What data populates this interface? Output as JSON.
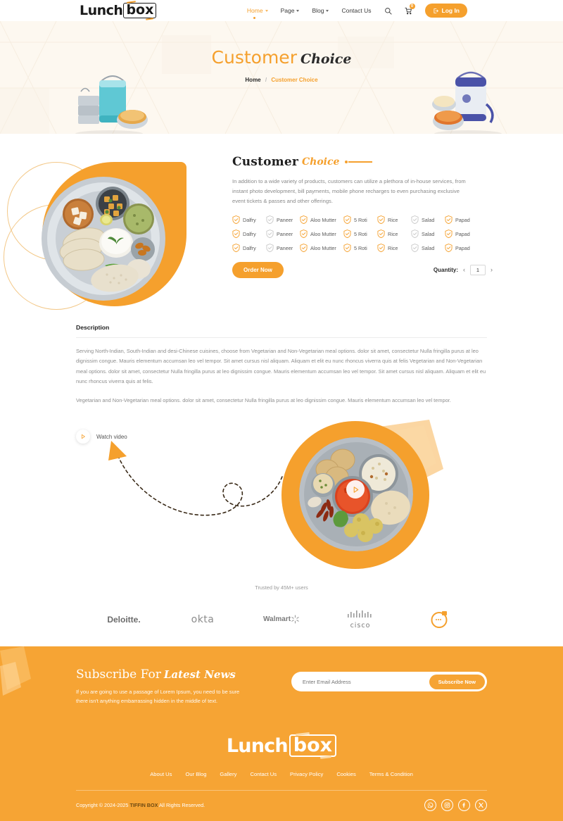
{
  "header": {
    "logo": {
      "part1": "Lunch",
      "part2": "box"
    },
    "nav": [
      {
        "label": "Home",
        "has_caret": true,
        "active": true
      },
      {
        "label": "Page",
        "has_caret": true,
        "active": false
      },
      {
        "label": "Blog",
        "has_caret": true,
        "active": false
      },
      {
        "label": "Contact Us",
        "has_caret": false,
        "active": false
      }
    ],
    "search_icon": "search-icon",
    "cart_icon": "cart-icon",
    "cart_count": "0",
    "login_label": "Log In"
  },
  "banner": {
    "title_part1": "Customer",
    "title_part2": "Choice",
    "breadcrumb_home": "Home",
    "breadcrumb_sep": "/",
    "breadcrumb_current": "Customer Choice"
  },
  "product": {
    "title_part1": "Customer",
    "title_part2": "Choice",
    "description": "In addition to a wide variety of products, customers can utilize a plethora of in-house services, from instant photo development, bill payments, mobile phone recharges to even purchasing exclusive event tickets & passes and other offerings.",
    "option_rows": [
      [
        {
          "label": "Dalfry",
          "checked": true
        },
        {
          "label": "Paneer",
          "checked": false
        },
        {
          "label": "Aloo Mutter",
          "checked": true
        },
        {
          "label": "5 Roti",
          "checked": true
        },
        {
          "label": "Rice",
          "checked": true
        },
        {
          "label": "Salad",
          "checked": false
        },
        {
          "label": "Papad",
          "checked": true
        }
      ],
      [
        {
          "label": "Dalfry",
          "checked": true
        },
        {
          "label": "Paneer",
          "checked": false
        },
        {
          "label": "Aloo Mutter",
          "checked": true
        },
        {
          "label": "5 Roti",
          "checked": true
        },
        {
          "label": "Rice",
          "checked": true
        },
        {
          "label": "Salad",
          "checked": false
        },
        {
          "label": "Papad",
          "checked": true
        }
      ],
      [
        {
          "label": "Dalfry",
          "checked": true
        },
        {
          "label": "Paneer",
          "checked": false
        },
        {
          "label": "Aloo Mutter",
          "checked": true
        },
        {
          "label": "5 Roti",
          "checked": true
        },
        {
          "label": "Rice",
          "checked": true
        },
        {
          "label": "Salad",
          "checked": false
        },
        {
          "label": "Papad",
          "checked": true
        }
      ]
    ],
    "order_label": "Order Now",
    "quantity_label": "Quantity:",
    "quantity_value": "1"
  },
  "description": {
    "heading": "Description",
    "paragraph1": "Serving North-Indian, South-Indian and desi-Chinese cuisines, choose from Vegetarian and Non-Vegetarian meal options. dolor sit amet, consectetur Nulla fringilla purus at leo dignissim congue. Mauris elementum accumsan leo vel tempor. Sit amet cursus nisl aliquam. Aliquam et elit eu nunc rhoncus viverra quis at felis Vegetarian and Non-Vegetarian meal options. dolor sit amet, consectetur Nulla fringilla purus at leo dignissim congue. Mauris elementum accumsan leo vel tempor. Sit amet cursus nisl aliquam. Aliquam et elit eu nunc rhoncus viverra quis at felis.",
    "paragraph2": "Vegetarian and Non-Vegetarian meal options. dolor sit amet, consectetur Nulla fringilla purus at leo dignissim congue. Mauris elementum accumsan leo vel tempor."
  },
  "video": {
    "watch_label": "Watch video"
  },
  "trusted": {
    "label": "Trusted by 45M+ users",
    "logos": [
      {
        "name": "Deloitte."
      },
      {
        "name": "okta"
      },
      {
        "name": "Walmart"
      },
      {
        "name": "cisco"
      },
      {
        "name": "ring-logo"
      }
    ]
  },
  "subscribe": {
    "title_part1": "Subscribe For",
    "title_part2": "Latest News",
    "text": "If you are going to use a passage of Lorem Ipsum, you need to be sure there isn't anything embarrassing hidden in the middle of text.",
    "input_placeholder": "Enter Email Address",
    "input_value": "",
    "button_label": "Subscribe Now"
  },
  "footer": {
    "logo": {
      "part1": "Lunch",
      "part2": "box"
    },
    "nav": [
      "About Us",
      "Our Blog",
      "Gallery",
      "Contact Us",
      "Privacy Policy",
      "Cookies",
      "Terms & Condition"
    ],
    "copyright_prefix": "Copyright © 2024-2025",
    "copyright_brand": "TIFFIN BOX",
    "copyright_suffix": "All Rights Reserved.",
    "socials": [
      "whatsapp-icon",
      "instagram-icon",
      "facebook-icon",
      "x-icon"
    ]
  },
  "colors": {
    "accent": "#f5a02d",
    "footer_bg": "#f6a434",
    "banner_bg": "#fdf8f0"
  }
}
